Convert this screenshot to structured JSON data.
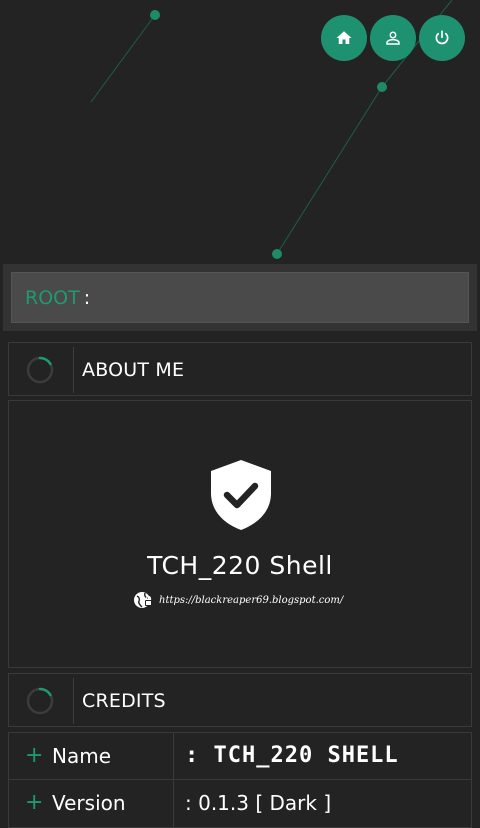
{
  "top_buttons": [
    {
      "name": "home",
      "icon": "home-icon"
    },
    {
      "name": "profile",
      "icon": "user-icon"
    },
    {
      "name": "logout",
      "icon": "power-icon"
    }
  ],
  "root": {
    "label": "ROOT",
    "separator": ":"
  },
  "about": {
    "header_label": "ABOUT ME"
  },
  "about_card": {
    "title": "TCH_220 Shell",
    "blog_url": "https://blackreaper69.blogspot.com/"
  },
  "credits": {
    "header_label": "CREDITS",
    "rows": [
      {
        "key": "Name",
        "value": ": TCH_220 SHELL"
      },
      {
        "key": "Version",
        "value": ": 0.1.3 [ Dark ]"
      }
    ]
  },
  "colors": {
    "accent": "#1e9270",
    "background": "#232323",
    "field": "#4a4a4a"
  }
}
